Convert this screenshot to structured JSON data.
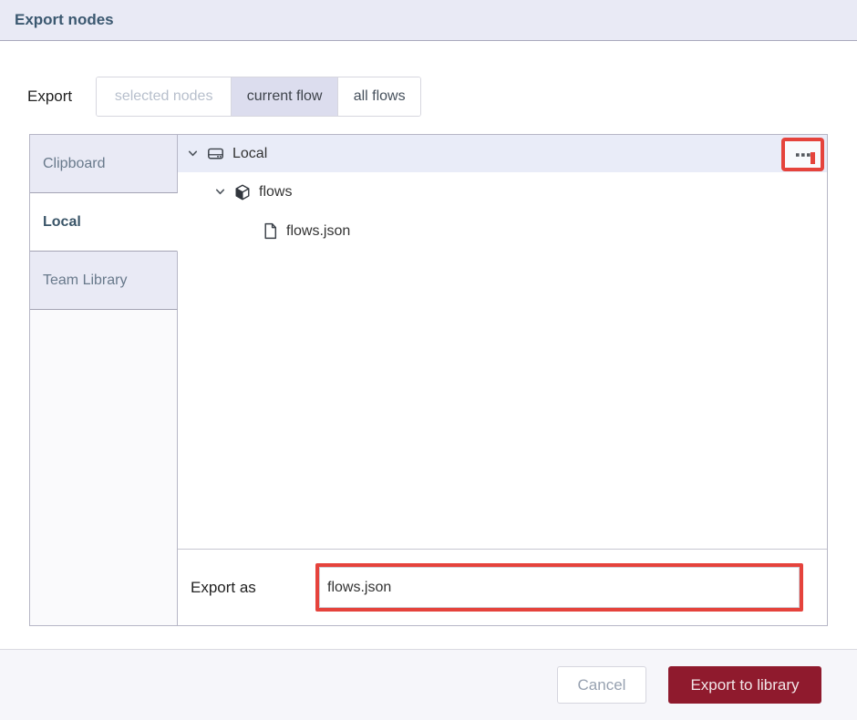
{
  "dialog": {
    "title": "Export nodes"
  },
  "export_row": {
    "label": "Export",
    "options": [
      {
        "label": "selected nodes",
        "state": "disabled"
      },
      {
        "label": "current flow",
        "state": "selected"
      },
      {
        "label": "all flows",
        "state": "normal"
      }
    ]
  },
  "library": {
    "tabs": [
      {
        "label": "Clipboard",
        "active": false
      },
      {
        "label": "Local",
        "active": true
      },
      {
        "label": "Team Library",
        "active": false
      }
    ],
    "tree": [
      {
        "label": "Local",
        "icon": "hard-drive-icon",
        "level": 0,
        "expanded": true,
        "selected": true
      },
      {
        "label": "flows",
        "icon": "package-icon",
        "level": 1,
        "expanded": true,
        "selected": false
      },
      {
        "label": "flows.json",
        "icon": "file-icon",
        "level": 2,
        "expanded": false,
        "selected": false
      }
    ],
    "menu_button": {
      "icon": "ellipsis-icon",
      "annotated": true
    },
    "export_as": {
      "label": "Export as",
      "value": "flows.json",
      "annotated": true
    }
  },
  "footer": {
    "cancel_label": "Cancel",
    "confirm_label": "Export to library"
  },
  "colors": {
    "annotation_red": "#e5433c",
    "primary_button_bg": "#8f1a2d",
    "header_bg": "#e9eaf5",
    "selected_segment_bg": "#dcddee",
    "tree_selected_row_bg": "#e9ecf8"
  }
}
